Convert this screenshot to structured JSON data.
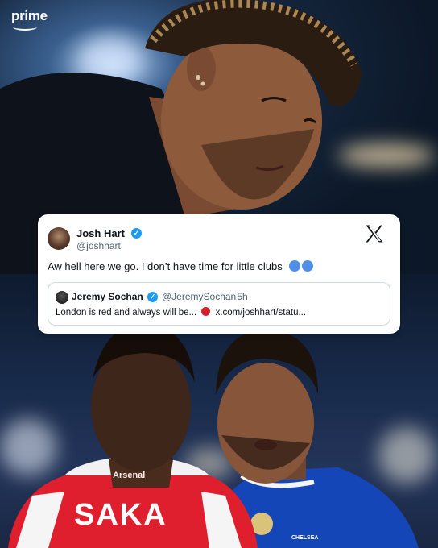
{
  "brand": {
    "logo_text": "prime"
  },
  "tweet": {
    "author_name": "Josh Hart",
    "author_handle": "@joshhart",
    "text": "Aw hell here we go. I don’t have time for little clubs",
    "emoji_color": "#4f8fe8",
    "platform_icon": "x-logo-icon",
    "verified_color": "#1d9bf0",
    "quoted": {
      "author_name": "Jeremy Sochan",
      "author_handle": "@JeremySochan",
      "time": "· 5h",
      "text_before": "London is red and always will be...",
      "emoji_color": "#d3202c",
      "link_text": "x.com/joshhart/statu..."
    }
  },
  "photo_bottom": {
    "left_player_name": "SAKA",
    "left_kit_sponsor": "Arsenal",
    "right_kit_crest": "CHELSEA"
  }
}
